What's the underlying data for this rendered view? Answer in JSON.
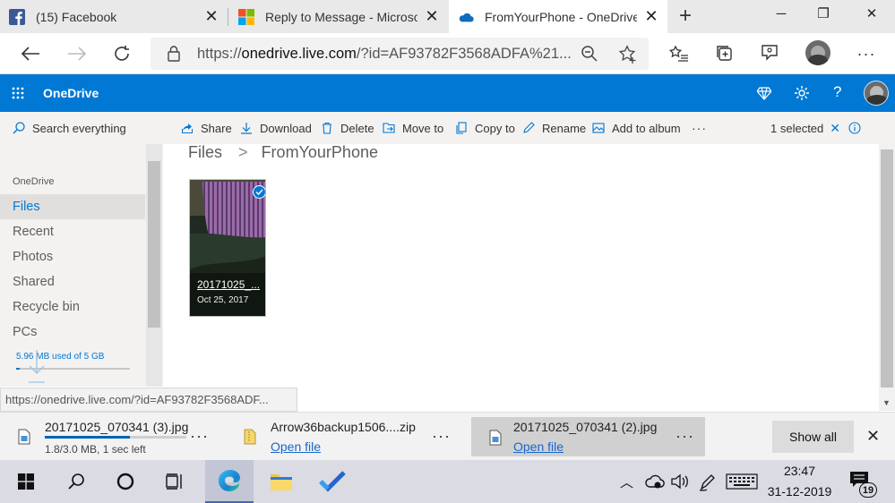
{
  "browser": {
    "tabs": [
      {
        "title": "(15) Facebook",
        "icon": "facebook-icon"
      },
      {
        "title": "Reply to Message - Microso",
        "icon": "microsoft-icon"
      },
      {
        "title": "FromYourPhone - OneDrive",
        "icon": "onedrive-cloud-icon"
      }
    ],
    "new_tab_symbol": "+",
    "url": "https://onedrive.live.com/?id=AF93782F3568ADFA%21...",
    "url_host": "onedrive.live.com",
    "url_prefix": "https://",
    "url_rest": "/?id=AF93782F3568ADFA%21..."
  },
  "suite": {
    "app_name": "OneDrive",
    "icons": [
      "waffle-icon",
      "premium-diamond-icon",
      "settings-icon",
      "help-icon",
      "avatar"
    ]
  },
  "sidebar": {
    "search_placeholder": "Search everything",
    "section_label": "OneDrive",
    "items": [
      {
        "label": "Files",
        "selected": true
      },
      {
        "label": "Recent",
        "selected": false
      },
      {
        "label": "Photos",
        "selected": false
      },
      {
        "label": "Shared",
        "selected": false
      },
      {
        "label": "Recycle bin",
        "selected": false
      },
      {
        "label": "PCs",
        "selected": false
      }
    ],
    "storage_text": "5.96 MB used of 5 GB"
  },
  "commands": {
    "share": "Share",
    "download": "Download",
    "delete": "Delete",
    "move_to": "Move to",
    "copy_to": "Copy to",
    "rename": "Rename",
    "add_to_album": "Add to album",
    "more": "···",
    "selected_count": "1 selected"
  },
  "breadcrumb": {
    "root": "Files",
    "separator": ">",
    "current": "FromYourPhone"
  },
  "files": [
    {
      "name": "20171025_...",
      "date": "Oct 25, 2017",
      "selected": true
    }
  ],
  "status_url": "https://onedrive.live.com/?id=AF93782F3568ADF...",
  "downloads": [
    {
      "name": "20171025_070341 (3).jpg",
      "sub": "1.8/3.0 MB, 1 sec left",
      "progress": 0.6
    },
    {
      "name": "Arrow36backup1506....zip",
      "sub": "Open file"
    },
    {
      "name": "20171025_070341 (2).jpg",
      "sub": "Open file"
    }
  ],
  "download_bar": {
    "show_all": "Show all",
    "more": "···"
  },
  "taskbar": {
    "time": "23:47",
    "date": "31-12-2019",
    "notification_count": "19"
  },
  "colors": {
    "onedrive_blue": "#0078d4",
    "tabstrip": "#e9e9e9",
    "taskbar": "#dadbe3"
  }
}
